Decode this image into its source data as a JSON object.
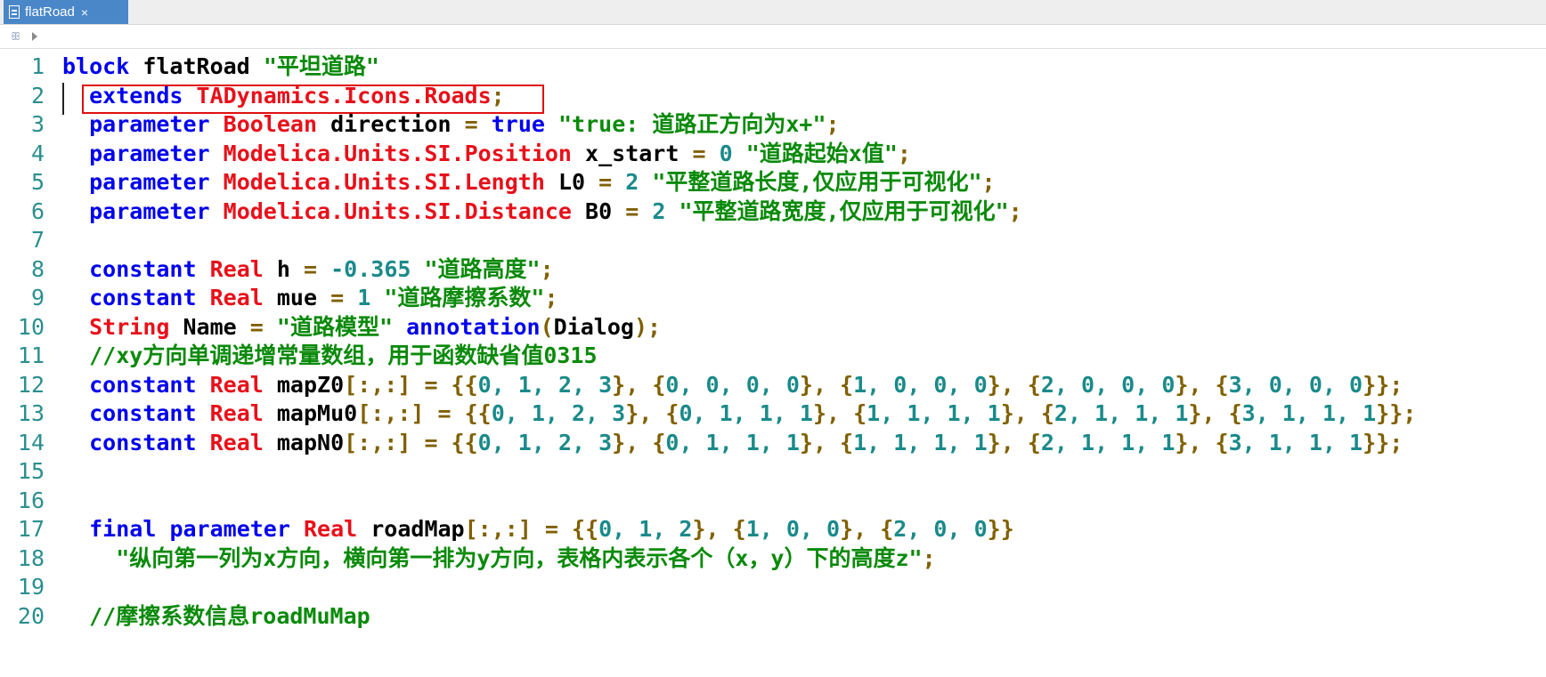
{
  "tab": {
    "title": "flatRoad",
    "close": "×"
  },
  "nav": {
    "icon": "ꕥ"
  },
  "line_numbers": [
    "1",
    "2",
    "3",
    "4",
    "5",
    "6",
    "7",
    "8",
    "9",
    "10",
    "11",
    "12",
    "13",
    "14",
    "15",
    "16",
    "17",
    "18",
    "19",
    "20"
  ],
  "code": {
    "l1": [
      "block",
      " ",
      "flatRoad",
      " ",
      "\"平坦道路\""
    ],
    "l2": [
      "  ",
      "extends",
      " ",
      "TADynamics.Icons.Roads",
      ";"
    ],
    "l3": [
      "  ",
      "parameter",
      " ",
      "Boolean",
      " ",
      "direction",
      " ",
      "=",
      " ",
      "true",
      " ",
      "\"true: 道路正方向为x+\"",
      ";"
    ],
    "l4": [
      "  ",
      "parameter",
      " ",
      "Modelica.Units.SI.Position",
      " ",
      "x_start",
      " ",
      "=",
      " ",
      "0",
      " ",
      "\"道路起始x值\"",
      ";"
    ],
    "l5": [
      "  ",
      "parameter",
      " ",
      "Modelica.Units.SI.Length",
      " ",
      "L0",
      " ",
      "=",
      " ",
      "2",
      " ",
      "\"平整道路长度,仅应用于可视化\"",
      ";"
    ],
    "l6": [
      "  ",
      "parameter",
      " ",
      "Modelica.Units.SI.Distance",
      " ",
      "B0",
      " ",
      "=",
      " ",
      "2",
      " ",
      "\"平整道路宽度,仅应用于可视化\"",
      ";"
    ],
    "l8": [
      "  ",
      "constant",
      " ",
      "Real",
      " ",
      "h",
      " ",
      "=",
      " ",
      "-0.365",
      " ",
      "\"道路高度\"",
      ";"
    ],
    "l9": [
      "  ",
      "constant",
      " ",
      "Real",
      " ",
      "mue",
      " ",
      "=",
      " ",
      "1",
      " ",
      "\"道路摩擦系数\"",
      ";"
    ],
    "l10": [
      "  ",
      "String",
      " ",
      "Name",
      " ",
      "=",
      " ",
      "\"道路模型\"",
      " ",
      "annotation",
      "(",
      "Dialog",
      ");"
    ],
    "l11": [
      "  ",
      "//xy方向单调递增常量数组，用于函数缺省值0315"
    ],
    "l12": [
      "  ",
      "constant",
      " ",
      "Real",
      " ",
      "mapZ0",
      "[:,:] = {{",
      "0, 1, 2, 3",
      "}, {",
      "0, 0, 0, 0",
      "}, {",
      "1, 0, 0, 0",
      "}, {",
      "2, 0, 0, 0",
      "}, {",
      "3, 0, 0, 0",
      "}};"
    ],
    "l13": [
      "  ",
      "constant",
      " ",
      "Real",
      " ",
      "mapMu0",
      "[:,:] = {{",
      "0, 1, 2, 3",
      "}, {",
      "0, 1, 1, 1",
      "}, {",
      "1, 1, 1, 1",
      "}, {",
      "2, 1, 1, 1",
      "}, {",
      "3, 1, 1, 1",
      "}};"
    ],
    "l14": [
      "  ",
      "constant",
      " ",
      "Real",
      " ",
      "mapN0",
      "[:,:] = {{",
      "0, 1, 2, 3",
      "}, {",
      "0, 1, 1, 1",
      "}, {",
      "1, 1, 1, 1",
      "}, {",
      "2, 1, 1, 1",
      "}, {",
      "3, 1, 1, 1",
      "}};"
    ],
    "l17": [
      "  ",
      "final",
      " ",
      "parameter",
      " ",
      "Real",
      " ",
      "roadMap",
      "[:,:] = {{",
      "0, 1, 2",
      "}, {",
      "1, 0, 0",
      "}, {",
      "2, 0, 0",
      "}}"
    ],
    "l18": [
      "    ",
      "\"纵向第一列为x方向，横向第一排为y方向，表格内表示各个（x，y）下的高度z\"",
      ";"
    ],
    "l20": [
      "  ",
      "//摩擦系数信息roadMuMap"
    ]
  },
  "colors": {
    "keyword": "#0000ee",
    "type": "#e8101a",
    "number": "#1b8a8a",
    "string": "#0a8a0a",
    "operator": "#806000",
    "tab_active": "#4a87c9",
    "highlight_box": "#e01010"
  }
}
